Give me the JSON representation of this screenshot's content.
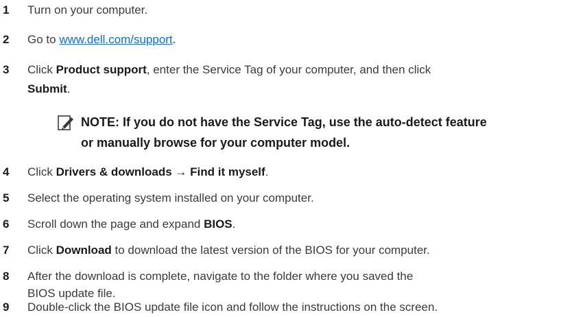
{
  "steps": [
    {
      "num": "1",
      "text": "Turn on your computer."
    },
    {
      "num": "2",
      "pre": "Go to ",
      "link": "www.dell.com/support",
      "post": "."
    },
    {
      "num": "3",
      "pre": "Click ",
      "bold1": "Product support",
      "mid": ", enter the Service Tag of your computer, and then click",
      "bold2": "Submit",
      "post": "."
    },
    {
      "num": "4",
      "pre": "Click ",
      "bold1": "Drivers & downloads",
      "arrow": " → ",
      "bold2": "Find it myself",
      "post": "."
    },
    {
      "num": "5",
      "text": "Select the operating system installed on your computer."
    },
    {
      "num": "6",
      "pre": "Scroll down the page and expand ",
      "bold1": "BIOS",
      "post": "."
    },
    {
      "num": "7",
      "pre": "Click ",
      "bold1": "Download",
      "post": " to download the latest version of the BIOS for your computer."
    },
    {
      "num": "8",
      "line1": "After the download is complete, navigate to the folder where you saved the",
      "line2": "BIOS update file."
    },
    {
      "num": "9",
      "text": "Double-click the BIOS update file icon and follow the instructions on the screen."
    }
  ],
  "note": {
    "line1": "NOTE: If you do not have the Service Tag, use the auto-detect feature",
    "line2": "or manually browse for your computer model."
  }
}
